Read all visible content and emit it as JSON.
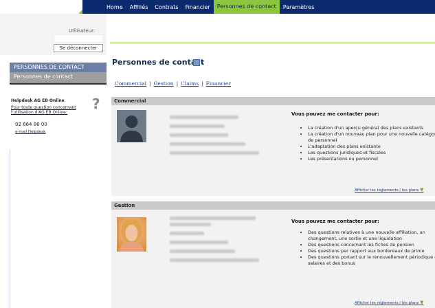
{
  "nav": {
    "items": [
      "Home",
      "Affiliés",
      "Contrats",
      "Financier",
      "Personnes de contact",
      "Paramètres"
    ],
    "active": "Personnes de contact"
  },
  "sidebar": {
    "user_label": "Utilisateur:",
    "logout_label": "Se déconnecter",
    "section_label": "PERSONNES DE CONTACT",
    "subitem_label": "Personnes de contact",
    "helpdesk": {
      "title": "Helpdesk AG EB Online",
      "question_link": "Pour toute question concernant l'utilisation d'AG EB Online:",
      "phone": "02 664 86 00",
      "email_link": "e-mail Helpdesk"
    }
  },
  "page": {
    "title": "Personnes de contact",
    "subnav": [
      "Commercial",
      "Gestion",
      "Claims",
      "Financier"
    ]
  },
  "sections": [
    {
      "header": "Commercial",
      "contact_title": "Vous pouvez me contacter pour:",
      "bullets": [
        "La création d'un aperçu général des plans existants",
        "La création d'un nouveau plan pour une nouvelle catégorie de personnel",
        "L'adaptation des plans existante",
        "Les questions juridiques et fiscales",
        "Les présentations ou personnel"
      ],
      "more_link": "Afficher les règlements / les plans"
    },
    {
      "header": "Gestion",
      "contact_title": "Vous pouvez me contacter pour:",
      "bullets": [
        "Des questions relatives à une nouvelle affiliation, un changement, une sortie et une liquidation",
        "Des questions concernant les fiches de pension",
        "Des questions par rapport aux bordereaux de prime",
        "Des questions portant sur le renouvellement périodique des salaires et des bonus"
      ],
      "more_link": "Afficher les règlements / les plans"
    }
  ],
  "colors": {
    "navy": "#0c2a6e",
    "accent_green": "#8cc63f",
    "link_blue": "#1b3f8c"
  }
}
